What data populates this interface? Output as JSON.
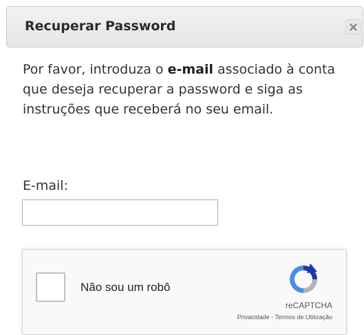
{
  "dialog": {
    "title": "Recuperar Password",
    "close_icon": "close-icon"
  },
  "instructions": {
    "prefix": "Por favor, introduza o ",
    "bold": "e-mail",
    "suffix": " associado à conta que deseja recuperar a password e siga as instruções que receberá no seu email."
  },
  "form": {
    "email_label": "E-mail:",
    "email_value": "",
    "email_placeholder": ""
  },
  "recaptcha": {
    "checkbox_label": "Não sou um robô",
    "brand": "reCAPTCHA",
    "privacy": "Privacidade",
    "separator": " - ",
    "terms": "Termos de Utilização",
    "logo_icon": "recaptcha-logo-icon",
    "colors": {
      "blue": "#4a90e2",
      "dark_blue": "#1c3aa9",
      "grey": "#b3b3b3"
    }
  }
}
